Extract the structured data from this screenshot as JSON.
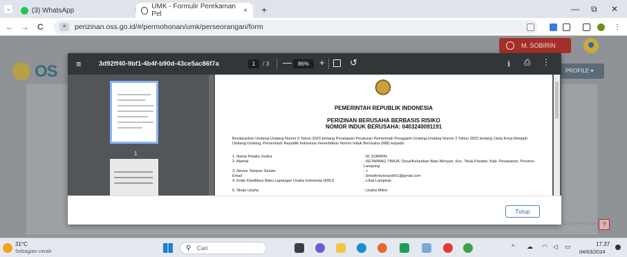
{
  "browser": {
    "tabs": [
      {
        "title": "(3) WhatsApp",
        "close": "×"
      },
      {
        "title": "UMK - Formulir Perekaman Pel",
        "close": "×"
      }
    ],
    "new_tab": "+",
    "window_controls": {
      "minimize": "—",
      "restore": "⧉",
      "close": "✕"
    },
    "nav": {
      "back": "←",
      "forward": "→",
      "reload": "C"
    },
    "url": "perizinan.oss.go.id/#/permohonan/umk/perseorangan/form"
  },
  "page": {
    "user_name": "M. SOBIRIN",
    "logo_text": "OS",
    "profile_button": "PROFILE ▾",
    "faint_text": "Kirim Permohonan",
    "help_label": "?"
  },
  "pdf_viewer": {
    "menu": "≡",
    "title": "3d92ff40-9bf1-4b4f-b90d-43ce5ac86f7a",
    "current_page": "1",
    "total_pages": "/ 3",
    "zoom_minus": "—",
    "zoom": "86%",
    "zoom_plus": "+",
    "rotate": "↺",
    "download": "⭳",
    "print": "⎙",
    "more": "⋮",
    "thumbnail_page": "1"
  },
  "document": {
    "heading1": "PEMERINTAH REPUBLIK INDONESIA",
    "heading2": "PERIZINAN BERUSAHA BERBASIS RISIKO",
    "heading3": "NOMOR INDUK BERUSAHA: 0403240091191",
    "intro": "Berdasarkan Undang-Undang Nomor 6 Tahun 2023 tentang Penetapan Peraturan Pemerintah Pengganti Undang-Undang Nomor 2 Tahun 2022 tentang Cipta Kerja Menjadi Undang-Undang, Pemerintah Republik Indonesia menerbitkan Nomor Induk Berusaha (NIB) kepada:",
    "fields": [
      {
        "label": "1. Nama Pelaku Usaha",
        "value": ": M. SOBIRIN"
      },
      {
        "label": "2. Alamat",
        "value": ": KETAPANG TIMUR, Desa/Kelurahan Batu Menyan, Kec. Teluk Pandan, Kab. Pesawaran, Provinsi Lampung"
      },
      {
        "label": "3. Nomor Telepon Seluler",
        "value": ": +"
      },
      {
        "label": "   Email",
        "value": ": bimafentyansyah51@gmail.com"
      },
      {
        "label": "4. Kode Klasifikasi Baku Lapangan Usaha Indonesia (KBLI)",
        "value": ": Lihat Lampiran"
      },
      {
        "label": "5. Skala Usaha",
        "value": ": Usaha Mikro"
      }
    ]
  },
  "modal": {
    "close_button": "Tutup"
  },
  "taskbar": {
    "weather_temp": "31°C",
    "weather_desc": "Sebagian cerah",
    "search_placeholder": "Cari",
    "tray_chevron": "^",
    "time": "17.37",
    "date": "04/03/2024"
  }
}
